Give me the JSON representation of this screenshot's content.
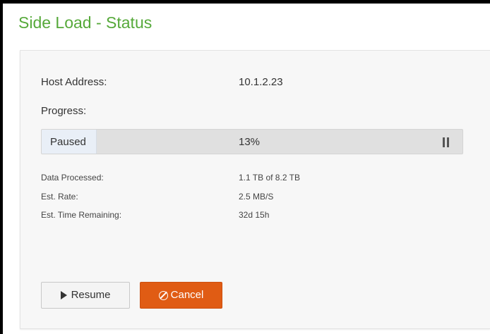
{
  "dialog": {
    "title": "Side Load - Status"
  },
  "details": {
    "host_label": "Host Address:",
    "host_value": "10.1.2.23",
    "progress_label": "Progress:"
  },
  "progress": {
    "status": "Paused",
    "percent_text": "13%",
    "fraction": 0.13,
    "control_icon": "pause-icon"
  },
  "stats": [
    {
      "label": "Data Processed:",
      "value": "1.1 TB of 8.2 TB"
    },
    {
      "label": "Est. Rate:",
      "value": "2.5 MB/S"
    },
    {
      "label": "Est. Time Remaining:",
      "value": "32d 15h"
    }
  ],
  "buttons": {
    "resume_label": "Resume",
    "resume_icon": "play-icon",
    "cancel_label": "Cancel",
    "cancel_icon": "ban-icon"
  },
  "colors": {
    "title": "#56a93a",
    "cancel_button": "#e05c14",
    "progress_fill": "#e9eff7"
  }
}
